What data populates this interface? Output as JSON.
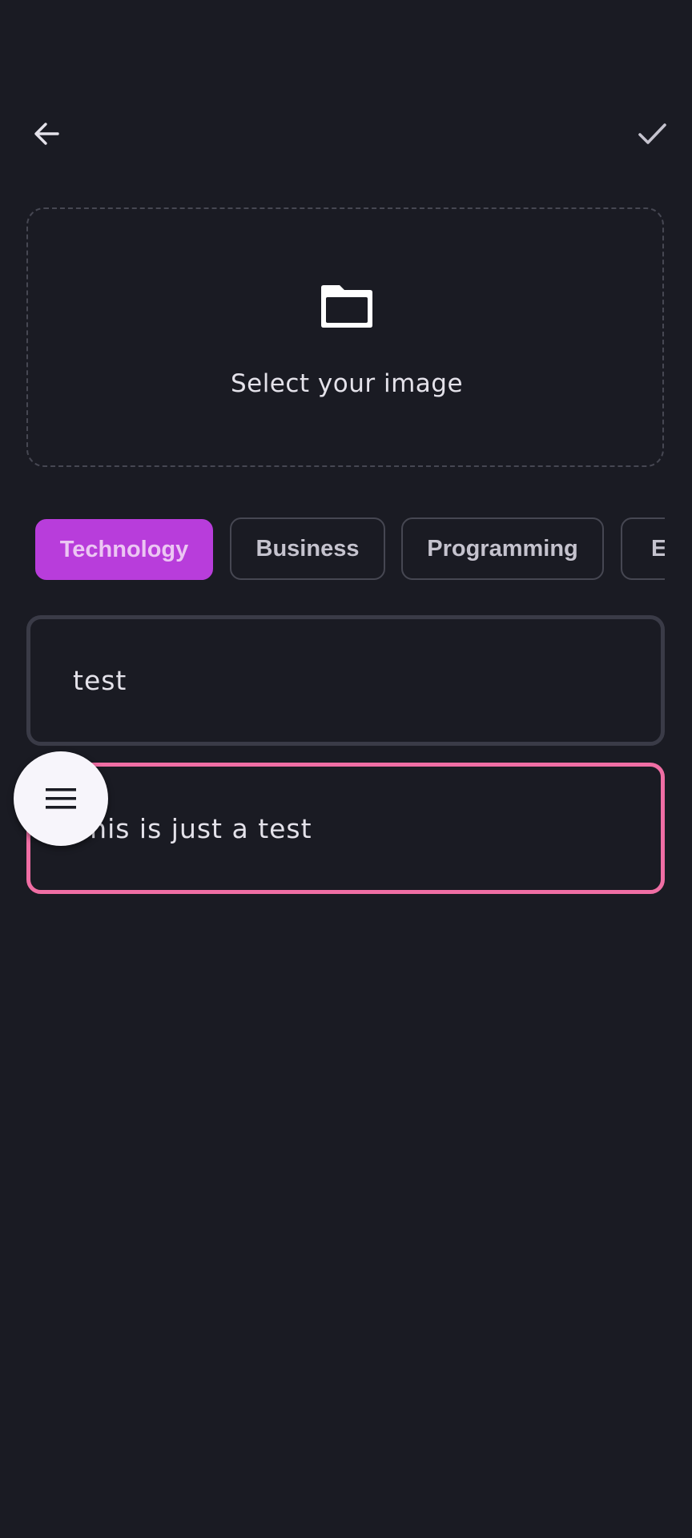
{
  "header": {
    "back_icon": "arrow-left-icon",
    "confirm_icon": "check-icon"
  },
  "image_picker": {
    "icon": "folder-icon",
    "label": "Select your image"
  },
  "categories": [
    {
      "label": "Technology",
      "selected": true
    },
    {
      "label": "Business",
      "selected": false
    },
    {
      "label": "Programming",
      "selected": false
    },
    {
      "label": "En",
      "selected": false
    }
  ],
  "title_field": {
    "value": "test"
  },
  "description_field": {
    "value": "This is just a test"
  },
  "menu_fab": {
    "icon": "menu-icon"
  },
  "colors": {
    "background": "#1a1b23",
    "accent": "#b83ddb",
    "focused_border": "#f06ea4",
    "outline": "#464752"
  }
}
